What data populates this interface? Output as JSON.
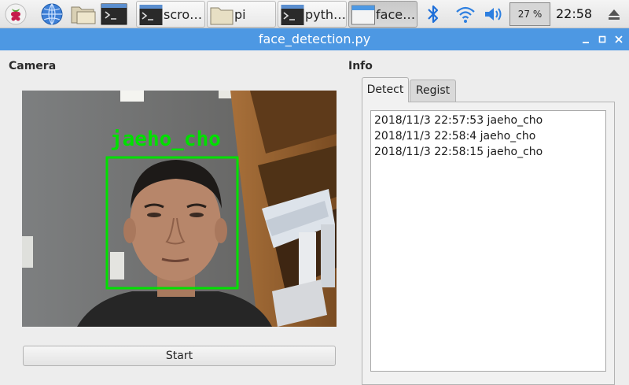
{
  "taskbar": {
    "launchers": [
      {
        "icon": "raspberry-menu-icon"
      },
      {
        "icon": "web-browser-icon"
      },
      {
        "icon": "file-manager-icon"
      },
      {
        "icon": "terminal-icon"
      }
    ],
    "windows": [
      {
        "label": "scro…",
        "icon": "terminal-icon",
        "active": false
      },
      {
        "label": "pi",
        "icon": "folder-icon",
        "active": false
      },
      {
        "label": "pyth…",
        "icon": "terminal-icon",
        "active": false
      },
      {
        "label": "face…",
        "icon": "window-icon",
        "active": true
      }
    ],
    "tray": {
      "cpu_label": "27 %",
      "cpu_percent": 27,
      "clock": "22:58",
      "icons": [
        "bluetooth-icon",
        "wifi-icon",
        "volume-icon",
        "eject-icon"
      ]
    }
  },
  "window": {
    "title": "face_detection.py",
    "controls": [
      "minimize-icon",
      "maximize-icon",
      "close-icon"
    ]
  },
  "camera": {
    "label": "Camera",
    "detection_label": "jaeho_cho",
    "detection_color": "#00e000",
    "start_button": "Start"
  },
  "info": {
    "label": "Info",
    "tabs": [
      {
        "label": "Detect",
        "selected": true
      },
      {
        "label": "Regist",
        "selected": false
      }
    ],
    "log": [
      "2018/11/3 22:57:53 jaeho_cho",
      "2018/11/3 22:58:4 jaeho_cho",
      "2018/11/3 22:58:15 jaeho_cho"
    ]
  },
  "colors": {
    "titlebar": "#4d98e3",
    "accent_bluetooth": "#1e6fd9"
  }
}
